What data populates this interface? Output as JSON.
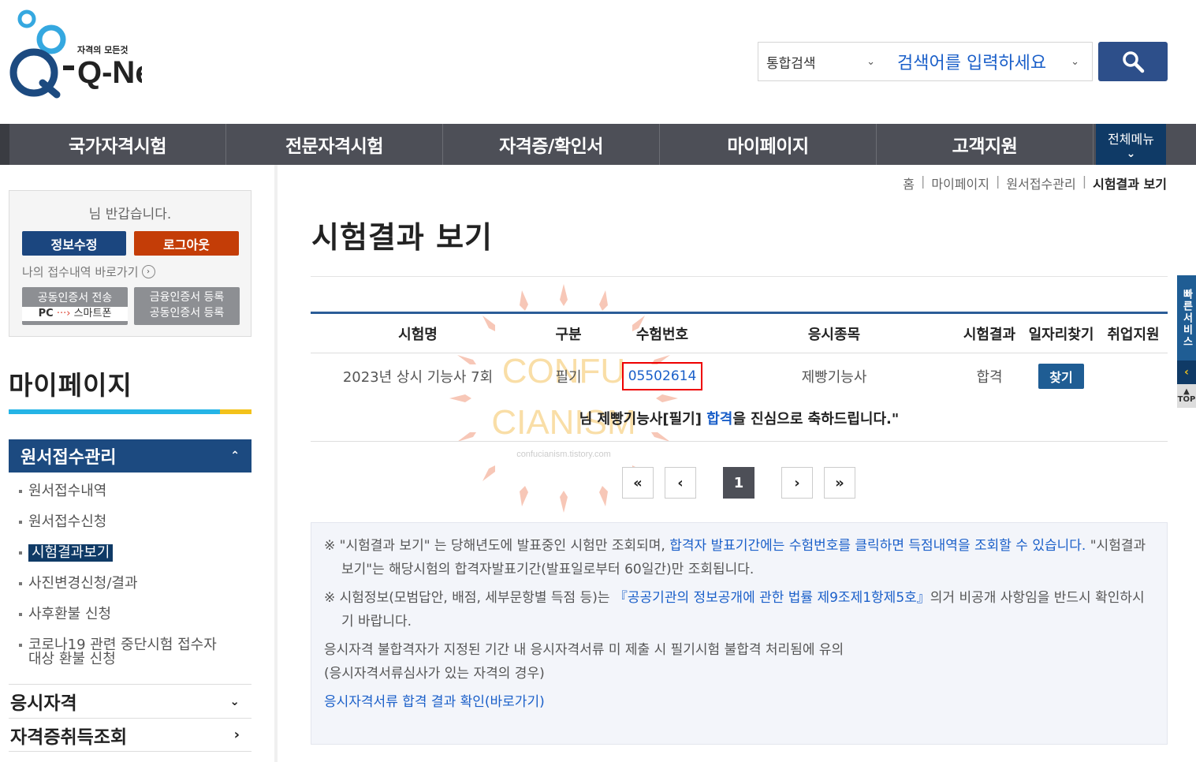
{
  "header": {
    "logo_text": "Q-Net",
    "logo_tagline": "자격의 모든것",
    "search_scope": "통합검색",
    "search_placeholder": "검색어를 입력하세요"
  },
  "gnb": {
    "items": [
      "국가자격시험",
      "전문자격시험",
      "자격증/확인서",
      "마이페이지",
      "고객지원"
    ],
    "all_menu": "전체메뉴"
  },
  "sidebar": {
    "greeting": "님 반갑습니다.",
    "edit_info": "정보수정",
    "logout": "로그아웃",
    "my_apply_link": "나의 접수내역 바로가기",
    "cert_transfer_line1": "공동인증서 전송",
    "cert_transfer_pc": "PC",
    "cert_transfer_phone": "스마트폰",
    "fin_cert_line1": "금융인증서 등록",
    "fin_cert_line2": "공동인증서 등록",
    "section_title": "마이페이지",
    "menu_open": "원서접수관리",
    "sub_items": [
      "원서접수내역",
      "원서접수신청",
      "시험결과보기",
      "사진변경신청/결과",
      "사후환불 신청",
      "코로나19 관련 중단시험 접수자",
      "대상 환불 신청"
    ],
    "menu_2": "응시자격",
    "menu_3": "자격증취득조회"
  },
  "breadcrumb": [
    "홈",
    "마이페이지",
    "원서접수관리",
    "시험결과 보기"
  ],
  "page_title": "시험결과 보기",
  "table": {
    "headers": [
      "시험명",
      "구분",
      "수험번호",
      "응시종목",
      "시험결과",
      "일자리찾기",
      "취업지원"
    ],
    "row": {
      "exam_name": "2023년 상시 기능사 7회",
      "type": "필기",
      "exam_number": "05502614",
      "subject": "제빵기능사",
      "result": "합격",
      "find_label": "찾기"
    },
    "congrats_pre": "님 제빵기능사[필기] ",
    "congrats_pass": "합격",
    "congrats_post": "을 진심으로 축하드립니다.\""
  },
  "pager": {
    "first": "«",
    "prev": "‹",
    "current": "1",
    "next": "›",
    "last": "»"
  },
  "notice": {
    "n1_a": "※ \"시험결과 보기\" 는 당해년도에 발표중인 시험만 조회되며, ",
    "n1_b": "합격자 발표기간에는 수험번호를 클릭하면 득점내역을 조회할 수 있습니다.",
    "n1_c": " \"시험결과보기\"는 해당시험의 합격자발표기간(발표일로부터 60일간)만 조회됩니다.",
    "n2_a": "※ 시험정보(모범답안, 배점, 세부문항별 득점 등)는 ",
    "n2_b": "『공공기관의 정보공개에 관한 법률 제9조제1항제5호』",
    "n2_c": "의거 비공개 사항임을 반드시 확인하시기 바랍니다.",
    "n3": "응시자격 불합격자가 지정된 기간 내 응시자격서류 미 제출 시 필기시험 불합격 처리됨에 유의",
    "n4": "(응시자격서류심사가 있는 자격의 경우)",
    "link": "응시자격서류 합격 결과 확인(바로가기)"
  },
  "watermark": {
    "line1": "CONFU",
    "line2": "CIANISM",
    "url": "confucianism.tistory.com"
  },
  "quick": {
    "label": "빠른서비스",
    "top": "TOP"
  }
}
